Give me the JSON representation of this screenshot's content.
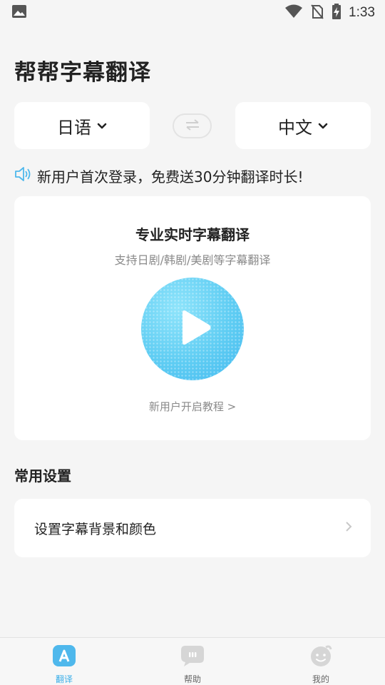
{
  "status_bar": {
    "time": "1:33",
    "icons": [
      "image-icon",
      "wifi-icon",
      "no-sim-icon",
      "battery-charging-icon"
    ]
  },
  "app": {
    "title": "帮帮字幕翻译"
  },
  "languages": {
    "source": "日语",
    "target": "中文",
    "swap_icon": "swap-arrows-icon"
  },
  "notice": {
    "icon": "speaker-icon",
    "text": "新用户首次登录，免费送30分钟翻译时长!"
  },
  "main_card": {
    "title": "专业实时字幕翻译",
    "subtitle": "支持日剧/韩剧/美剧等字幕翻译",
    "play_icon": "play-icon",
    "tutorial_link": "新用户开启教程 >"
  },
  "settings": {
    "section_title": "常用设置",
    "items": [
      {
        "label": "设置字幕背景和颜色",
        "icon": "chevron-right-icon"
      }
    ]
  },
  "bottom_nav": {
    "items": [
      {
        "label": "翻译",
        "icon": "translate-icon",
        "active": true
      },
      {
        "label": "帮助",
        "icon": "chat-bubble-icon",
        "active": false
      },
      {
        "label": "我的",
        "icon": "smiley-icon",
        "active": false
      }
    ]
  },
  "colors": {
    "accent": "#3aaee8",
    "play_gradient_light": "#8fe4fb",
    "play_gradient_dark": "#45baf0",
    "background": "#f5f5f5",
    "card": "#ffffff"
  }
}
